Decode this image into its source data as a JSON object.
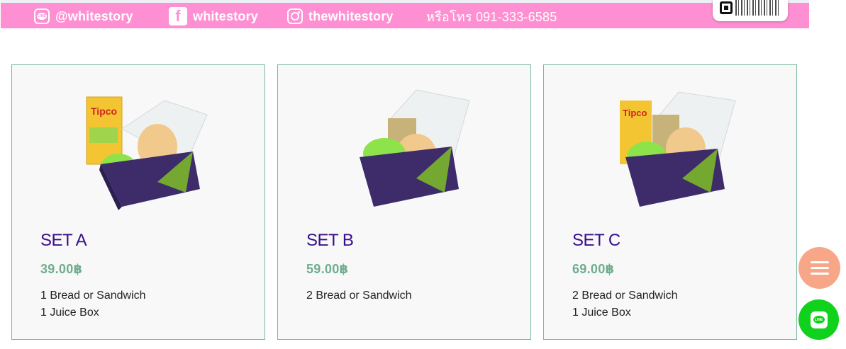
{
  "header": {
    "line_id": "@whitestory",
    "facebook": "whitestory",
    "instagram": "thewhitestory",
    "phone": "หรือโทร 091-333-6585",
    "line_icon_text": "LINE"
  },
  "products": [
    {
      "title": "SET A",
      "price": "39.00฿",
      "lines": [
        "1 Bread or Sandwich",
        "1 Juice Box"
      ]
    },
    {
      "title": "SET B",
      "price": "59.00฿",
      "lines": [
        "2 Bread or Sandwich",
        ""
      ]
    },
    {
      "title": "SET C",
      "price": "69.00฿",
      "lines": [
        "2 Bread or Sandwich",
        "1 Juice Box"
      ]
    }
  ],
  "fabs": {
    "line_label": "LINE"
  },
  "colors": {
    "topbar": "#ff8fd3",
    "title": "#3a0e8a",
    "price": "#6fae8e",
    "card_border": "#77b79a",
    "menu_fab": "#f7a788",
    "line_fab": "#10d11b"
  },
  "icons": [
    "line-icon",
    "facebook-icon",
    "instagram-icon",
    "qr-code-icon",
    "menu-icon",
    "line-chat-icon"
  ]
}
